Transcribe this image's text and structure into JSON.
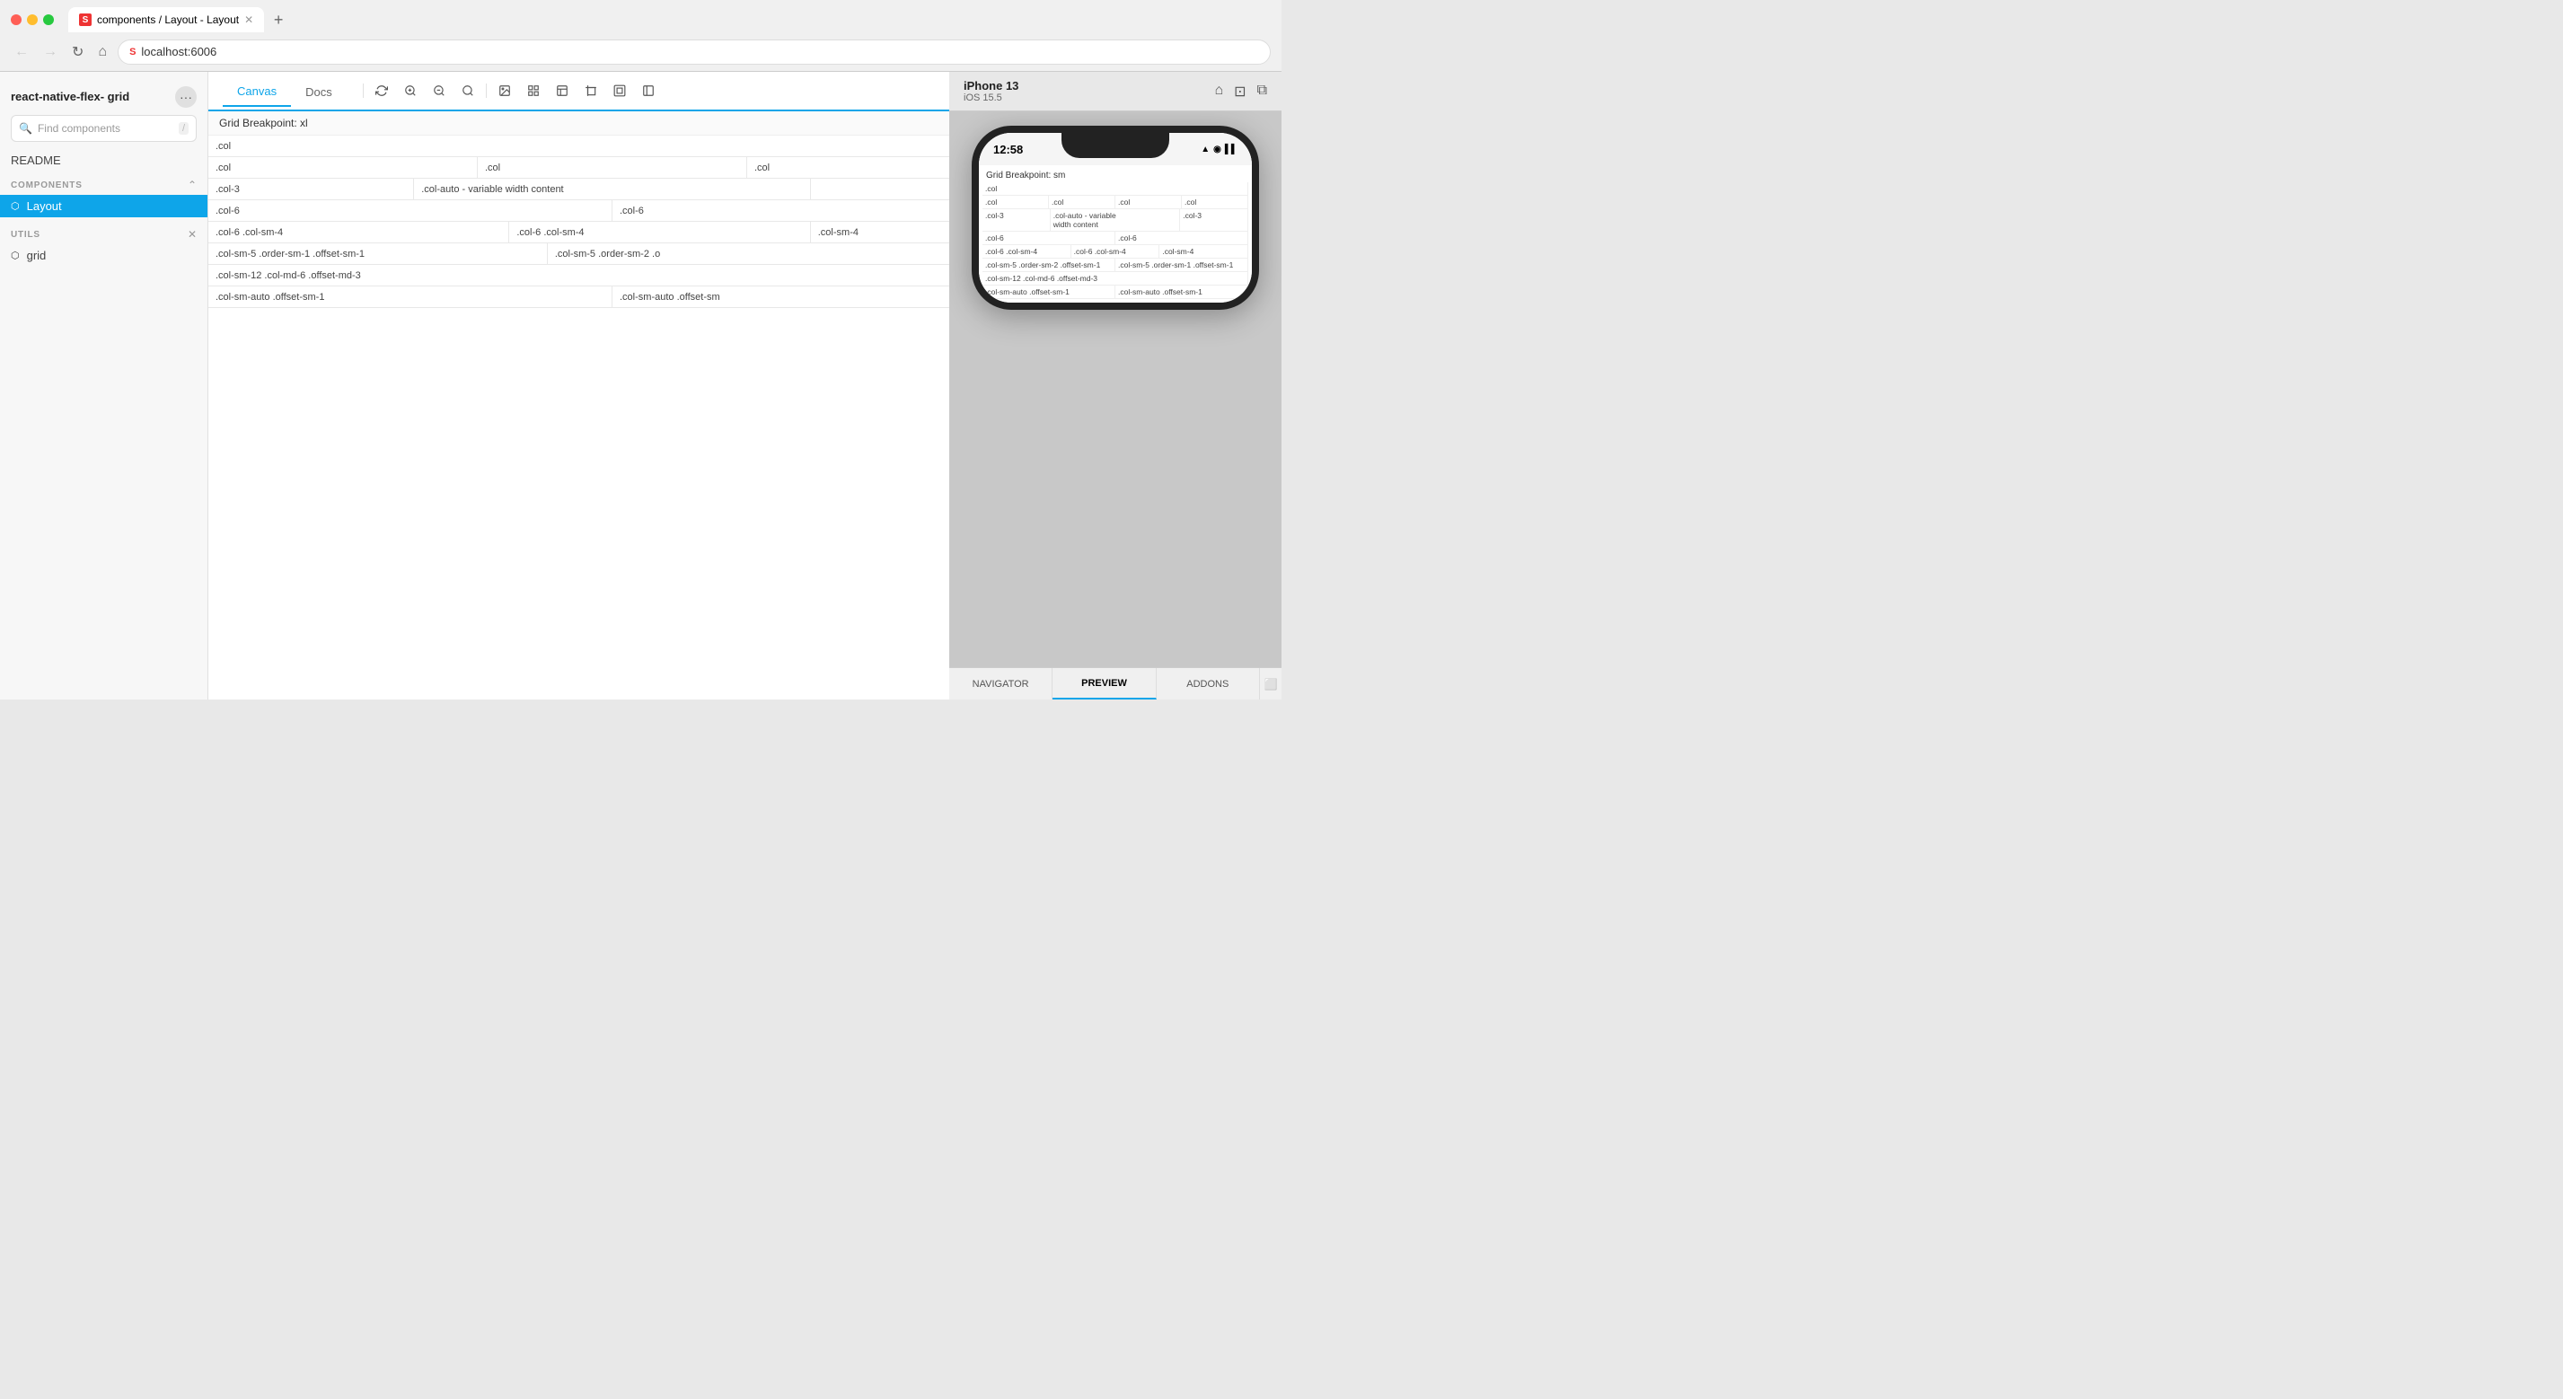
{
  "browser": {
    "tab_title": "components / Layout - Layout",
    "tab_favicon": "S",
    "url": "localhost:6006",
    "new_tab_label": "+"
  },
  "sidebar": {
    "project_title": "react-native-flex-\ngrid",
    "more_btn_label": "···",
    "search_placeholder": "Find components",
    "search_shortcut": "/",
    "readme_label": "README",
    "components_section_label": "COMPONENTS",
    "utils_section_label": "UTILS",
    "components": [
      {
        "label": "Layout",
        "active": true
      }
    ],
    "utils": [
      {
        "label": "grid",
        "active": false
      }
    ]
  },
  "canvas": {
    "tab_canvas_label": "Canvas",
    "tab_docs_label": "Docs",
    "toolbar_icons": [
      "refresh",
      "zoom-in",
      "zoom-out",
      "search",
      "image",
      "grid",
      "layout",
      "crop",
      "frame",
      "sidebar"
    ],
    "grid": {
      "breakpoint_label": "Grid Breakpoint: xl",
      "rows": [
        {
          "cells": [
            ".col"
          ]
        },
        {
          "cells": [
            ".col",
            ".col",
            ".col"
          ]
        },
        {
          "cells": [
            ".col-3",
            "",
            ".col-auto - variable width content",
            ""
          ]
        },
        {
          "cells": [
            ".col-6",
            "",
            ".col-6"
          ]
        },
        {
          "cells": [
            ".col-6 .col-sm-4",
            "",
            ".col-6 .col-sm-4",
            "",
            ".col-sm-4"
          ]
        },
        {
          "cells": [
            ".col-sm-5 .order-sm-1 .offset-sm-1",
            "",
            ".col-sm-5 .order-sm-2 .o"
          ]
        },
        {
          "cells": [
            ".col-sm-12 .col-md-6 .offset-md-3"
          ]
        },
        {
          "cells": [
            ".col-sm-auto .offset-sm-1",
            "",
            ".col-sm-auto .offset-sm"
          ]
        }
      ]
    }
  },
  "phone": {
    "device_name": "iPhone 13",
    "device_os": "iOS 15.5",
    "time": "12:58",
    "status_icons": "▲ ◉ ▌▌",
    "grid": {
      "breakpoint_label": "Grid Breakpoint: sm",
      "rows": [
        {
          "cells": [
            ".col"
          ]
        },
        {
          "cells": [
            ".col",
            ".col",
            ".col",
            ".col"
          ]
        },
        {
          "cells": [
            ".col-3",
            ".col-auto - variable\nwidth content",
            ".col-3"
          ]
        },
        {
          "cells": [
            ".col-6",
            ".col-6"
          ]
        },
        {
          "cells": [
            ".col-6 .col-sm-4",
            ".col-6 .col-sm-4",
            ".col-sm-4"
          ]
        },
        {
          "cells": [
            ".col-sm-5 .order-sm-2 .offset-sm-1",
            ".col-sm-5 .order-sm-1 .offset-sm-1"
          ]
        },
        {
          "cells": [
            ".col-sm-12 .col-md-6 .offset-md-3"
          ]
        },
        {
          "cells": [
            ".col-sm-auto .offset-sm-1",
            ".col-sm-auto .offset-sm-1"
          ]
        }
      ]
    },
    "bottom_tabs": [
      "NAVIGATOR",
      "PREVIEW",
      "ADDONS"
    ]
  }
}
